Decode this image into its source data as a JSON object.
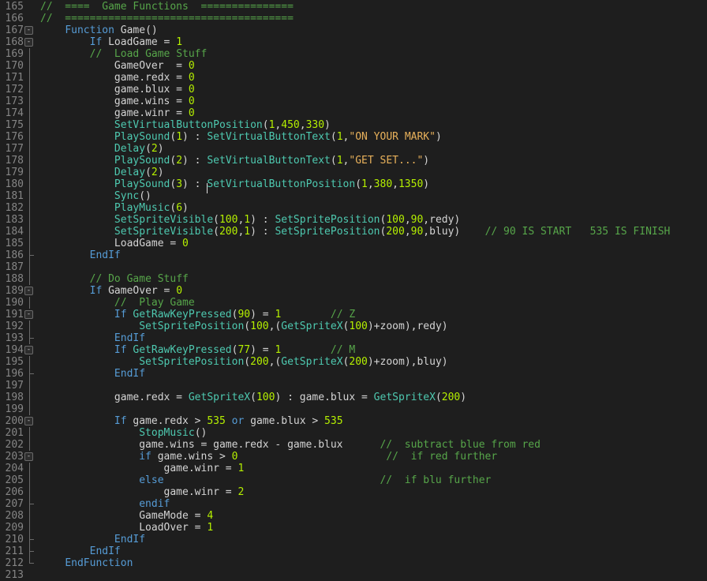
{
  "editor": {
    "lines": [
      {
        "n": "165",
        "segs": [
          {
            "t": "//  ====  Game Functions  ===============",
            "c": "cm"
          }
        ]
      },
      {
        "n": "166",
        "segs": [
          {
            "t": "//  =====================================",
            "c": "cm"
          }
        ]
      },
      {
        "n": "167",
        "fold": true,
        "segs": [
          {
            "t": "    ",
            "c": "def"
          },
          {
            "t": "Function",
            "c": "kw"
          },
          {
            "t": " Game()",
            "c": "def"
          }
        ]
      },
      {
        "n": "168",
        "fold": true,
        "segs": [
          {
            "t": "        ",
            "c": "def"
          },
          {
            "t": "If",
            "c": "kw"
          },
          {
            "t": " LoadGame = ",
            "c": "def"
          },
          {
            "t": "1",
            "c": "num"
          }
        ]
      },
      {
        "n": "169",
        "segs": [
          {
            "t": "        ",
            "c": "def"
          },
          {
            "t": "//  Load Game Stuff",
            "c": "cm"
          }
        ]
      },
      {
        "n": "170",
        "segs": [
          {
            "t": "            GameOver  = ",
            "c": "def"
          },
          {
            "t": "0",
            "c": "num"
          }
        ]
      },
      {
        "n": "171",
        "segs": [
          {
            "t": "            game.redx = ",
            "c": "def"
          },
          {
            "t": "0",
            "c": "num"
          }
        ]
      },
      {
        "n": "172",
        "segs": [
          {
            "t": "            game.blux = ",
            "c": "def"
          },
          {
            "t": "0",
            "c": "num"
          }
        ]
      },
      {
        "n": "173",
        "segs": [
          {
            "t": "            game.wins = ",
            "c": "def"
          },
          {
            "t": "0",
            "c": "num"
          }
        ]
      },
      {
        "n": "174",
        "segs": [
          {
            "t": "            game.winr = ",
            "c": "def"
          },
          {
            "t": "0",
            "c": "num"
          }
        ]
      },
      {
        "n": "175",
        "segs": [
          {
            "t": "            ",
            "c": "def"
          },
          {
            "t": "SetVirtualButtonPosition",
            "c": "fn"
          },
          {
            "t": "(",
            "c": "def"
          },
          {
            "t": "1",
            "c": "num"
          },
          {
            "t": ",",
            "c": "def"
          },
          {
            "t": "450",
            "c": "num"
          },
          {
            "t": ",",
            "c": "def"
          },
          {
            "t": "330",
            "c": "num"
          },
          {
            "t": ")",
            "c": "def"
          }
        ]
      },
      {
        "n": "176",
        "segs": [
          {
            "t": "            ",
            "c": "def"
          },
          {
            "t": "PlaySound",
            "c": "fn"
          },
          {
            "t": "(",
            "c": "def"
          },
          {
            "t": "1",
            "c": "num"
          },
          {
            "t": ") : ",
            "c": "def"
          },
          {
            "t": "SetVirtualButtonText",
            "c": "fn"
          },
          {
            "t": "(",
            "c": "def"
          },
          {
            "t": "1",
            "c": "num"
          },
          {
            "t": ",",
            "c": "def"
          },
          {
            "t": "\"ON YOUR MARK\"",
            "c": "str"
          },
          {
            "t": ")",
            "c": "def"
          }
        ]
      },
      {
        "n": "177",
        "segs": [
          {
            "t": "            ",
            "c": "def"
          },
          {
            "t": "Delay",
            "c": "fn"
          },
          {
            "t": "(",
            "c": "def"
          },
          {
            "t": "2",
            "c": "num"
          },
          {
            "t": ")",
            "c": "def"
          }
        ]
      },
      {
        "n": "178",
        "segs": [
          {
            "t": "            ",
            "c": "def"
          },
          {
            "t": "PlaySound",
            "c": "fn"
          },
          {
            "t": "(",
            "c": "def"
          },
          {
            "t": "2",
            "c": "num"
          },
          {
            "t": ") : ",
            "c": "def"
          },
          {
            "t": "SetVirtualButtonText",
            "c": "fn"
          },
          {
            "t": "(",
            "c": "def"
          },
          {
            "t": "1",
            "c": "num"
          },
          {
            "t": ",",
            "c": "def"
          },
          {
            "t": "\"GET SET...\"",
            "c": "str"
          },
          {
            "t": ")",
            "c": "def"
          }
        ]
      },
      {
        "n": "179",
        "segs": [
          {
            "t": "            ",
            "c": "def"
          },
          {
            "t": "Delay",
            "c": "fn"
          },
          {
            "t": "(",
            "c": "def"
          },
          {
            "t": "2",
            "c": "num"
          },
          {
            "t": ")",
            "c": "def"
          }
        ]
      },
      {
        "n": "180",
        "segs": [
          {
            "t": "            ",
            "c": "def"
          },
          {
            "t": "PlaySound",
            "c": "fn"
          },
          {
            "t": "(",
            "c": "def"
          },
          {
            "t": "3",
            "c": "num"
          },
          {
            "t": ") : ",
            "c": "def"
          },
          {
            "t": "|",
            "c": "caret"
          },
          {
            "t": "SetVirtualButtonPosition",
            "c": "fn"
          },
          {
            "t": "(",
            "c": "def"
          },
          {
            "t": "1",
            "c": "num"
          },
          {
            "t": ",",
            "c": "def"
          },
          {
            "t": "380",
            "c": "num"
          },
          {
            "t": ",",
            "c": "def"
          },
          {
            "t": "1350",
            "c": "num"
          },
          {
            "t": ")",
            "c": "def"
          }
        ]
      },
      {
        "n": "181",
        "segs": [
          {
            "t": "            ",
            "c": "def"
          },
          {
            "t": "Sync",
            "c": "fn"
          },
          {
            "t": "()",
            "c": "def"
          }
        ]
      },
      {
        "n": "182",
        "segs": [
          {
            "t": "            ",
            "c": "def"
          },
          {
            "t": "PlayMusic",
            "c": "fn"
          },
          {
            "t": "(",
            "c": "def"
          },
          {
            "t": "6",
            "c": "num"
          },
          {
            "t": ")",
            "c": "def"
          }
        ]
      },
      {
        "n": "183",
        "segs": [
          {
            "t": "            ",
            "c": "def"
          },
          {
            "t": "SetSpriteVisible",
            "c": "fn"
          },
          {
            "t": "(",
            "c": "def"
          },
          {
            "t": "100",
            "c": "num"
          },
          {
            "t": ",",
            "c": "def"
          },
          {
            "t": "1",
            "c": "num"
          },
          {
            "t": ") : ",
            "c": "def"
          },
          {
            "t": "SetSpritePosition",
            "c": "fn"
          },
          {
            "t": "(",
            "c": "def"
          },
          {
            "t": "100",
            "c": "num"
          },
          {
            "t": ",",
            "c": "def"
          },
          {
            "t": "90",
            "c": "num"
          },
          {
            "t": ",redy)",
            "c": "def"
          }
        ]
      },
      {
        "n": "184",
        "segs": [
          {
            "t": "            ",
            "c": "def"
          },
          {
            "t": "SetSpriteVisible",
            "c": "fn"
          },
          {
            "t": "(",
            "c": "def"
          },
          {
            "t": "200",
            "c": "num"
          },
          {
            "t": ",",
            "c": "def"
          },
          {
            "t": "1",
            "c": "num"
          },
          {
            "t": ") : ",
            "c": "def"
          },
          {
            "t": "SetSpritePosition",
            "c": "fn"
          },
          {
            "t": "(",
            "c": "def"
          },
          {
            "t": "200",
            "c": "num"
          },
          {
            "t": ",",
            "c": "def"
          },
          {
            "t": "90",
            "c": "num"
          },
          {
            "t": ",bluy)    ",
            "c": "def"
          },
          {
            "t": "// 90 IS START   535 IS FINISH",
            "c": "cm"
          }
        ]
      },
      {
        "n": "185",
        "segs": [
          {
            "t": "            LoadGame = ",
            "c": "def"
          },
          {
            "t": "0",
            "c": "num"
          }
        ]
      },
      {
        "n": "186",
        "end": true,
        "segs": [
          {
            "t": "        ",
            "c": "def"
          },
          {
            "t": "EndIf",
            "c": "kw"
          }
        ]
      },
      {
        "n": "187",
        "segs": []
      },
      {
        "n": "188",
        "segs": [
          {
            "t": "        ",
            "c": "def"
          },
          {
            "t": "// Do Game Stuff",
            "c": "cm"
          }
        ]
      },
      {
        "n": "189",
        "fold": true,
        "segs": [
          {
            "t": "        ",
            "c": "def"
          },
          {
            "t": "If",
            "c": "kw"
          },
          {
            "t": " GameOver = ",
            "c": "def"
          },
          {
            "t": "0",
            "c": "num"
          }
        ]
      },
      {
        "n": "190",
        "segs": [
          {
            "t": "            ",
            "c": "def"
          },
          {
            "t": "//  Play Game",
            "c": "cm"
          }
        ]
      },
      {
        "n": "191",
        "fold": true,
        "segs": [
          {
            "t": "            ",
            "c": "def"
          },
          {
            "t": "If",
            "c": "kw"
          },
          {
            "t": " ",
            "c": "def"
          },
          {
            "t": "GetRawKeyPressed",
            "c": "fn"
          },
          {
            "t": "(",
            "c": "def"
          },
          {
            "t": "90",
            "c": "num"
          },
          {
            "t": ") = ",
            "c": "def"
          },
          {
            "t": "1",
            "c": "num"
          },
          {
            "t": "        ",
            "c": "def"
          },
          {
            "t": "// Z",
            "c": "cm"
          }
        ]
      },
      {
        "n": "192",
        "segs": [
          {
            "t": "                ",
            "c": "def"
          },
          {
            "t": "SetSpritePosition",
            "c": "fn"
          },
          {
            "t": "(",
            "c": "def"
          },
          {
            "t": "100",
            "c": "num"
          },
          {
            "t": ",(",
            "c": "def"
          },
          {
            "t": "GetSpriteX",
            "c": "fn"
          },
          {
            "t": "(",
            "c": "def"
          },
          {
            "t": "100",
            "c": "num"
          },
          {
            "t": ")+zoom),redy)",
            "c": "def"
          }
        ]
      },
      {
        "n": "193",
        "end": true,
        "segs": [
          {
            "t": "            ",
            "c": "def"
          },
          {
            "t": "EndIf",
            "c": "kw"
          }
        ]
      },
      {
        "n": "194",
        "fold": true,
        "segs": [
          {
            "t": "            ",
            "c": "def"
          },
          {
            "t": "If",
            "c": "kw"
          },
          {
            "t": " ",
            "c": "def"
          },
          {
            "t": "GetRawKeyPressed",
            "c": "fn"
          },
          {
            "t": "(",
            "c": "def"
          },
          {
            "t": "77",
            "c": "num"
          },
          {
            "t": ") = ",
            "c": "def"
          },
          {
            "t": "1",
            "c": "num"
          },
          {
            "t": "        ",
            "c": "def"
          },
          {
            "t": "// M",
            "c": "cm"
          }
        ]
      },
      {
        "n": "195",
        "segs": [
          {
            "t": "                ",
            "c": "def"
          },
          {
            "t": "SetSpritePosition",
            "c": "fn"
          },
          {
            "t": "(",
            "c": "def"
          },
          {
            "t": "200",
            "c": "num"
          },
          {
            "t": ",(",
            "c": "def"
          },
          {
            "t": "GetSpriteX",
            "c": "fn"
          },
          {
            "t": "(",
            "c": "def"
          },
          {
            "t": "200",
            "c": "num"
          },
          {
            "t": ")+zoom),bluy)",
            "c": "def"
          }
        ]
      },
      {
        "n": "196",
        "end": true,
        "segs": [
          {
            "t": "            ",
            "c": "def"
          },
          {
            "t": "EndIf",
            "c": "kw"
          }
        ]
      },
      {
        "n": "197",
        "segs": []
      },
      {
        "n": "198",
        "segs": [
          {
            "t": "            game.redx = ",
            "c": "def"
          },
          {
            "t": "GetSpriteX",
            "c": "fn"
          },
          {
            "t": "(",
            "c": "def"
          },
          {
            "t": "100",
            "c": "num"
          },
          {
            "t": ") : game.blux = ",
            "c": "def"
          },
          {
            "t": "GetSpriteX",
            "c": "fn"
          },
          {
            "t": "(",
            "c": "def"
          },
          {
            "t": "200",
            "c": "num"
          },
          {
            "t": ")",
            "c": "def"
          }
        ]
      },
      {
        "n": "199",
        "segs": []
      },
      {
        "n": "200",
        "fold": true,
        "segs": [
          {
            "t": "            ",
            "c": "def"
          },
          {
            "t": "If",
            "c": "kw"
          },
          {
            "t": " game.redx > ",
            "c": "def"
          },
          {
            "t": "535",
            "c": "num"
          },
          {
            "t": " ",
            "c": "def"
          },
          {
            "t": "or",
            "c": "kw"
          },
          {
            "t": " game.blux > ",
            "c": "def"
          },
          {
            "t": "535",
            "c": "num"
          }
        ]
      },
      {
        "n": "201",
        "segs": [
          {
            "t": "                ",
            "c": "def"
          },
          {
            "t": "StopMusic",
            "c": "fn"
          },
          {
            "t": "()",
            "c": "def"
          }
        ]
      },
      {
        "n": "202",
        "segs": [
          {
            "t": "                game.wins = game.redx - game.blux      ",
            "c": "def"
          },
          {
            "t": "//  subtract blue from red",
            "c": "cm"
          }
        ]
      },
      {
        "n": "203",
        "fold": true,
        "segs": [
          {
            "t": "                ",
            "c": "def"
          },
          {
            "t": "if",
            "c": "kw"
          },
          {
            "t": " game.wins > ",
            "c": "def"
          },
          {
            "t": "0",
            "c": "num"
          },
          {
            "t": "                        ",
            "c": "def"
          },
          {
            "t": "//  if red further",
            "c": "cm"
          }
        ]
      },
      {
        "n": "204",
        "segs": [
          {
            "t": "                    game.winr = ",
            "c": "def"
          },
          {
            "t": "1",
            "c": "num"
          }
        ]
      },
      {
        "n": "205",
        "segs": [
          {
            "t": "                ",
            "c": "def"
          },
          {
            "t": "else",
            "c": "kw"
          },
          {
            "t": "                                   ",
            "c": "def"
          },
          {
            "t": "//  if blu further",
            "c": "cm"
          }
        ]
      },
      {
        "n": "206",
        "segs": [
          {
            "t": "                    game.winr = ",
            "c": "def"
          },
          {
            "t": "2",
            "c": "num"
          }
        ]
      },
      {
        "n": "207",
        "end": true,
        "segs": [
          {
            "t": "                ",
            "c": "def"
          },
          {
            "t": "endif",
            "c": "kw"
          }
        ]
      },
      {
        "n": "208",
        "segs": [
          {
            "t": "                GameMode = ",
            "c": "def"
          },
          {
            "t": "4",
            "c": "num"
          }
        ]
      },
      {
        "n": "209",
        "segs": [
          {
            "t": "                LoadOver = ",
            "c": "def"
          },
          {
            "t": "1",
            "c": "num"
          }
        ]
      },
      {
        "n": "210",
        "end": true,
        "segs": [
          {
            "t": "            ",
            "c": "def"
          },
          {
            "t": "EndIf",
            "c": "kw"
          }
        ]
      },
      {
        "n": "211",
        "end": true,
        "segs": [
          {
            "t": "        ",
            "c": "def"
          },
          {
            "t": "EndIf",
            "c": "kw"
          }
        ]
      },
      {
        "n": "212",
        "end": true,
        "segs": [
          {
            "t": "    ",
            "c": "def"
          },
          {
            "t": "EndFunction",
            "c": "kw"
          }
        ]
      },
      {
        "n": "213",
        "segs": []
      }
    ],
    "fold_glyph": "-"
  }
}
